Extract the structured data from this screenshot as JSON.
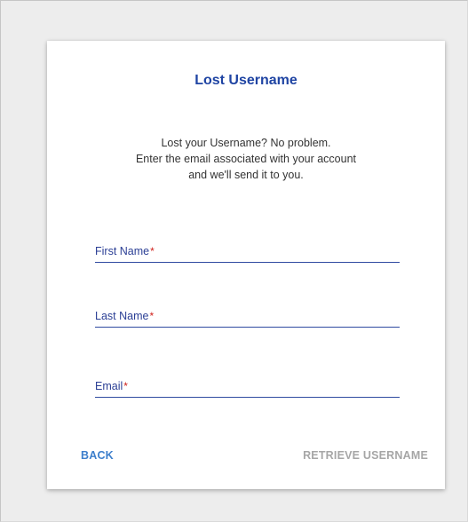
{
  "card": {
    "title": "Lost Username",
    "description": [
      "Lost your Username? No problem.",
      "Enter the email associated with your account",
      "and we'll send it to you."
    ]
  },
  "form": {
    "required_marker": "*",
    "fields": [
      {
        "label": "First Name",
        "value": ""
      },
      {
        "label": "Last Name",
        "value": ""
      },
      {
        "label": "Email",
        "value": ""
      }
    ]
  },
  "actions": {
    "back_label": "BACK",
    "retrieve_label": "RETRIEVE USERNAME"
  },
  "colors": {
    "title": "#1f44a3",
    "field_label": "#2b3f95",
    "required": "#d0201b",
    "back_button": "#3d7fcc",
    "retrieve_button_disabled": "#a6a6a6"
  }
}
